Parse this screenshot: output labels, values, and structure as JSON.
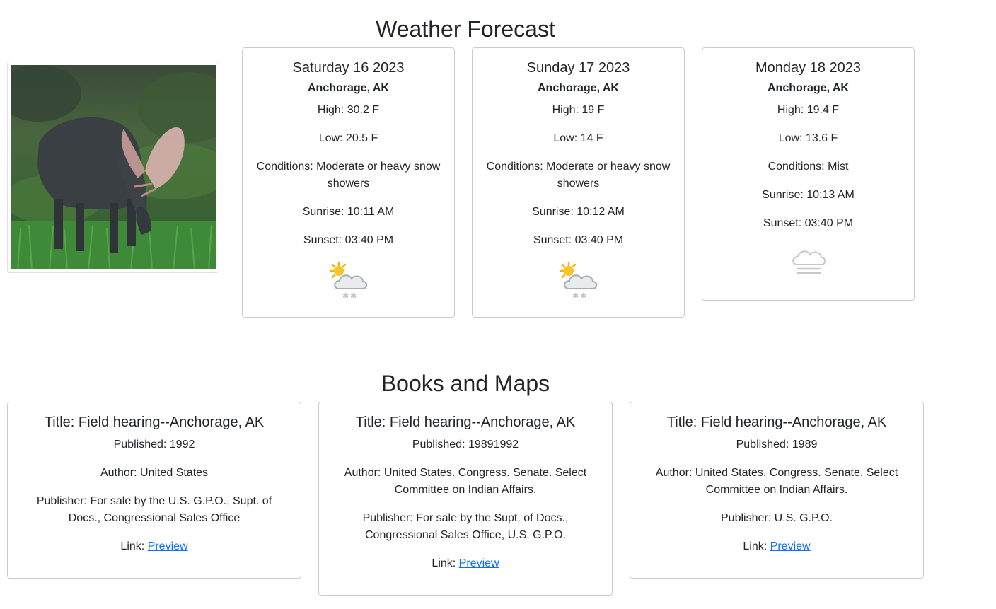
{
  "weather": {
    "title": "Weather Forecast",
    "cards": [
      {
        "date": "Saturday 16 2023",
        "location": "Anchorage, AK",
        "high": "High: 30.2 F",
        "low": "Low: 20.5 F",
        "conditions": "Conditions: Moderate or heavy snow showers",
        "sunrise": "Sunrise: 10:11 AM",
        "sunset": "Sunset: 03:40 PM",
        "icon": "sun-cloud-snow-icon"
      },
      {
        "date": "Sunday 17 2023",
        "location": "Anchorage, AK",
        "high": "High: 19 F",
        "low": "Low: 14 F",
        "conditions": "Conditions: Moderate or heavy snow showers",
        "sunrise": "Sunrise: 10:12 AM",
        "sunset": "Sunset: 03:40 PM",
        "icon": "sun-cloud-snow-icon"
      },
      {
        "date": "Monday 18 2023",
        "location": "Anchorage, AK",
        "high": "High: 19.4 F",
        "low": "Low: 13.6 F",
        "conditions": "Conditions: Mist",
        "sunrise": "Sunrise: 10:13 AM",
        "sunset": "Sunset: 03:40 PM",
        "icon": "mist-cloud-icon"
      }
    ]
  },
  "books": {
    "title": "Books and Maps",
    "cards": [
      {
        "title": "Title: Field hearing--Anchorage, AK",
        "published": "Published: 1992",
        "author": "Author: United States",
        "publisher": "Publisher: For sale by the U.S. G.P.O., Supt. of Docs., Congressional Sales Office",
        "link_label": "Link:",
        "link_text": "Preview"
      },
      {
        "title": "Title: Field hearing--Anchorage, AK",
        "published": "Published: 19891992",
        "author": "Author: United States. Congress. Senate. Select Committee on Indian Affairs.",
        "publisher": "Publisher: For sale by the Supt. of Docs., Congressional Sales Office, U.S. G.P.O.",
        "link_label": "Link:",
        "link_text": "Preview"
      },
      {
        "title": "Title: Field hearing--Anchorage, AK",
        "published": "Published: 1989",
        "author": "Author: United States. Congress. Senate. Select Committee on Indian Affairs.",
        "publisher": "Publisher: U.S. G.P.O.",
        "link_label": "Link:",
        "link_text": "Preview"
      }
    ]
  },
  "image": {
    "subject": "moose-grazing-photo"
  },
  "colors": {
    "link": "#0d6efd",
    "text": "#212529",
    "border": "#c9cdd1"
  }
}
